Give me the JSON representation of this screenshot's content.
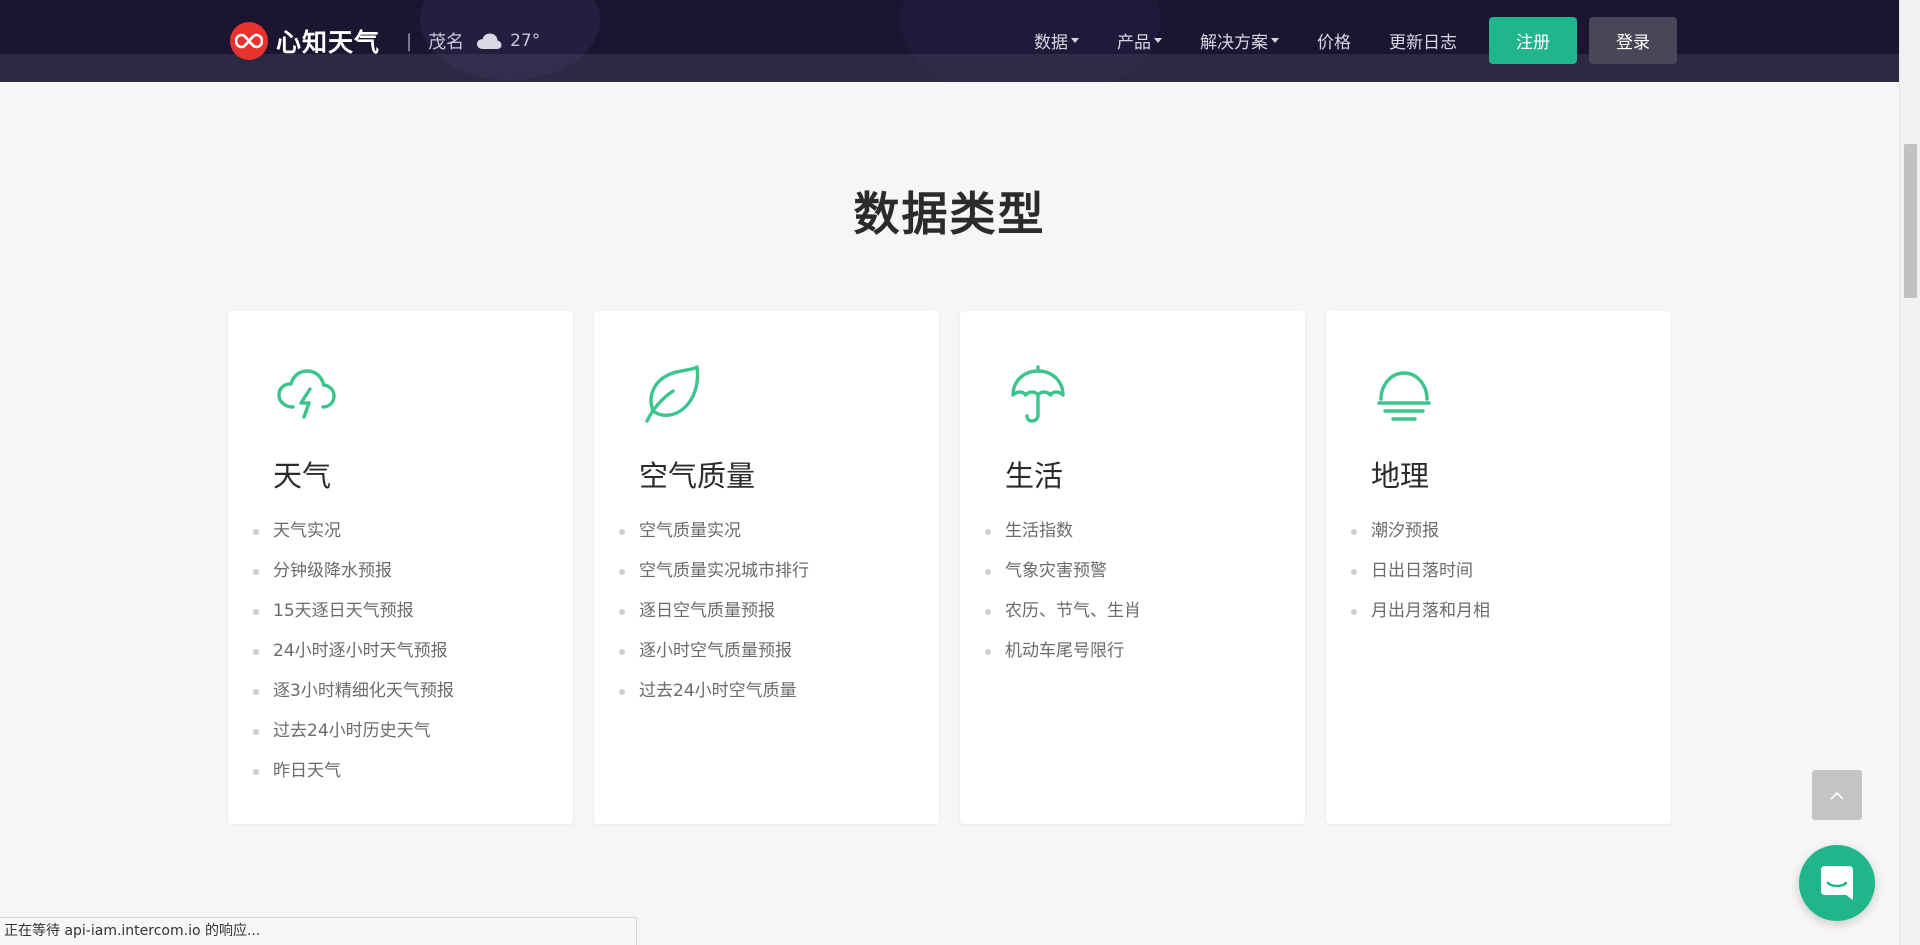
{
  "header": {
    "brand_name": "心知天气",
    "separator": "|",
    "city": "茂名",
    "temperature": "27°",
    "weather_icon": "cloud-icon",
    "nav": [
      {
        "label": "数据",
        "has_dropdown": true
      },
      {
        "label": "产品",
        "has_dropdown": true
      },
      {
        "label": "解决方案",
        "has_dropdown": true
      },
      {
        "label": "价格",
        "has_dropdown": false
      },
      {
        "label": "更新日志",
        "has_dropdown": false
      }
    ],
    "register_label": "注册",
    "login_label": "登录"
  },
  "section": {
    "title": "数据类型"
  },
  "cards": [
    {
      "icon": "cloud-lightning-icon",
      "title": "天气",
      "items": [
        "天气实况",
        "分钟级降水预报",
        "15天逐日天气预报",
        "24小时逐小时天气预报",
        "逐3小时精细化天气预报",
        "过去24小时历史天气",
        "昨日天气"
      ]
    },
    {
      "icon": "leaf-icon",
      "title": "空气质量",
      "items": [
        "空气质量实况",
        "空气质量实况城市排行",
        "逐日空气质量预报",
        "逐小时空气质量预报",
        "过去24小时空气质量"
      ]
    },
    {
      "icon": "umbrella-icon",
      "title": "生活",
      "items": [
        "生活指数",
        "气象灾害预警",
        "农历、节气、生肖",
        "机动车尾号限行"
      ]
    },
    {
      "icon": "sunset-icon",
      "title": "地理",
      "items": [
        "潮汐预报",
        "日出日落时间",
        "月出月落和月相"
      ]
    }
  ],
  "status_bar": {
    "text": "正在等待 api-iam.intercom.io 的响应..."
  },
  "colors": {
    "header_bg": "#1b1531",
    "accent_green": "#20b58b",
    "icon_green": "#3cc48f",
    "logo_red": "#e8322d"
  }
}
